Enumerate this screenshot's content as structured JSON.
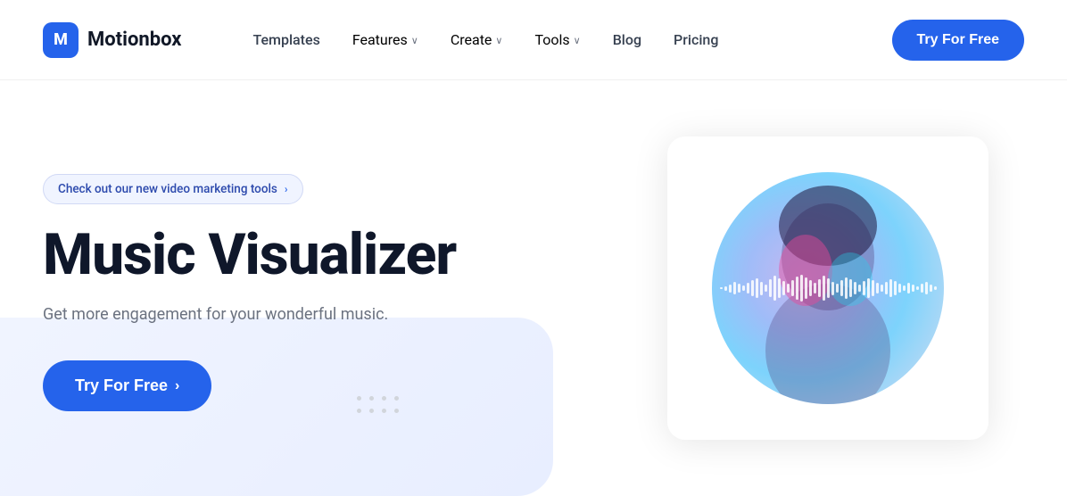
{
  "brand": {
    "logo_letter": "M",
    "logo_name": "Motionbox"
  },
  "nav": {
    "links": [
      {
        "label": "Templates",
        "has_dropdown": false
      },
      {
        "label": "Features",
        "has_dropdown": true
      },
      {
        "label": "Create",
        "has_dropdown": true
      },
      {
        "label": "Tools",
        "has_dropdown": true
      },
      {
        "label": "Blog",
        "has_dropdown": false
      },
      {
        "label": "Pricing",
        "has_dropdown": false
      }
    ],
    "cta_label": "Try For Free"
  },
  "hero": {
    "badge_text": "Check out our new video marketing tools",
    "title": "Music Visualizer",
    "subtitle": "Get more engagement for your wonderful music.",
    "cta_label": "Try For Free",
    "cta_arrow": "›"
  },
  "waveform": {
    "bars": [
      2,
      5,
      9,
      14,
      10,
      6,
      12,
      18,
      22,
      15,
      8,
      20,
      28,
      22,
      16,
      10,
      18,
      26,
      30,
      24,
      18,
      12,
      20,
      28,
      22,
      15,
      10,
      18,
      24,
      20,
      14,
      8,
      16,
      22,
      18,
      12,
      8,
      14,
      20,
      16,
      10,
      6,
      12,
      8,
      4,
      10,
      14,
      8,
      4
    ]
  }
}
